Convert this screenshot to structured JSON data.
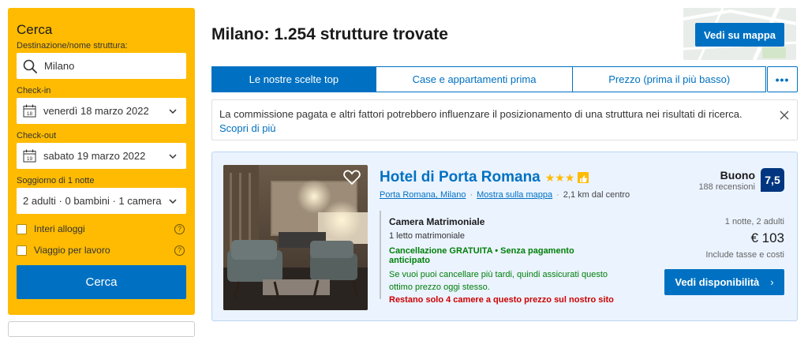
{
  "search": {
    "title": "Cerca",
    "destination_label": "Destinazione/nome struttura:",
    "destination_value": "Milano",
    "checkin_label": "Check-in",
    "checkin_value": "venerdì 18 marzo 2022",
    "checkin_day": "18",
    "checkout_label": "Check-out",
    "checkout_value": "sabato 19 marzo 2022",
    "checkout_day": "19",
    "stay_label": "Soggiorno di 1 notte",
    "occupancy_value": "2 adulti · 0 bambini · 1 camera",
    "checkbox_entire": "Interi alloggi",
    "checkbox_work": "Viaggio per lavoro",
    "submit_label": "Cerca"
  },
  "header": {
    "title": "Milano: 1.254 strutture trovate",
    "map_button": "Vedi su mappa"
  },
  "tabs": [
    {
      "label": "Le nostre scelte top"
    },
    {
      "label": "Case e appartamenti prima"
    },
    {
      "label": "Prezzo (prima il più basso)"
    },
    {
      "label": "•••"
    }
  ],
  "notice": {
    "text": "La commissione pagata e altri fattori potrebbero influenzare il posizionamento di una struttura nei risultati di ricerca. ",
    "link": "Scopri di più"
  },
  "property": {
    "name": "Hotel di Porta Romana",
    "stars": "★★★",
    "location_link": "Porta Romana, Milano",
    "map_link": "Mostra sulla mappa",
    "distance": "2,1 km dal centro",
    "rating_word": "Buono",
    "review_count": "188 recensioni",
    "score": "7,5",
    "room_name": "Camera Matrimoniale",
    "bed": "1 letto matrimoniale",
    "cancellation": "Cancellazione GRATUITA • Senza pagamento anticipato",
    "hint": "Se vuoi puoi cancellare più tardi, quindi assicurati questo ottimo prezzo oggi stesso.",
    "urgency": "Restano solo 4 camere a questo prezzo sul nostro sito",
    "price_meta": "1 notte, 2 adulti",
    "price": "€ 103",
    "price_note": "Include tasse e costi",
    "availability_button": "Vedi disponibilità",
    "availability_arrow": "›"
  },
  "colors": {
    "brand_yellow": "#febb02",
    "brand_blue": "#0071c2",
    "score_navy": "#003580",
    "green": "#008009",
    "red": "#cc0000"
  }
}
